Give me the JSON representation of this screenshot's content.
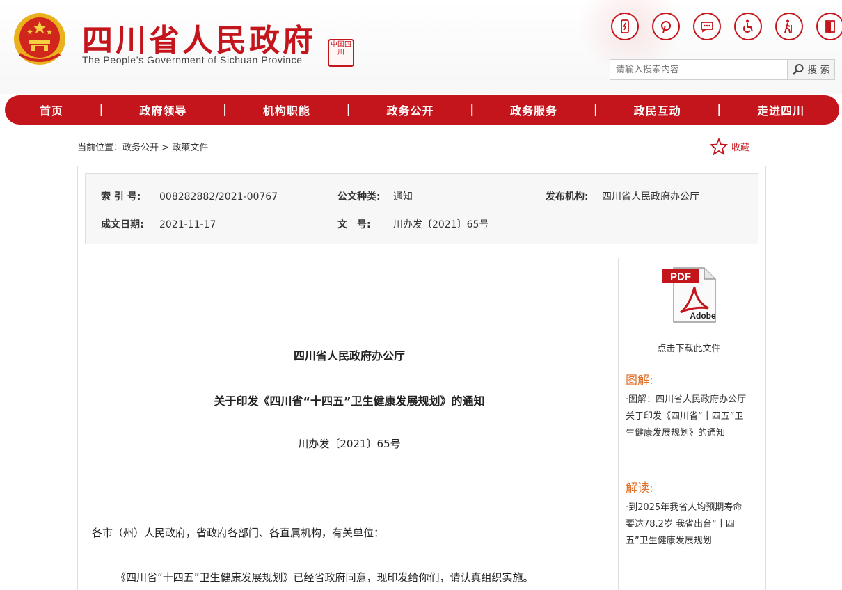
{
  "header": {
    "title": "四川省人民政府",
    "subtitle": "The People’s Government of Sichuan Province",
    "seal_text": "中国四川",
    "tools": [
      {
        "icon": "mobile-icon"
      },
      {
        "icon": "pinterest-icon"
      },
      {
        "icon": "message-icon"
      },
      {
        "icon": "accessibility-icon"
      },
      {
        "icon": "elderly-icon"
      },
      {
        "icon": "exit-icon"
      }
    ],
    "search": {
      "placeholder": "请输入搜索内容",
      "button_label": "搜 索"
    }
  },
  "nav": {
    "items": [
      "首页",
      "政府领导",
      "机构职能",
      "政务公开",
      "政务服务",
      "政民互动",
      "走进四川"
    ],
    "separator": "|"
  },
  "breadcrumb": {
    "prefix": "当前位置：",
    "level1": "政务公开",
    "sep": " > ",
    "level2": "政策文件"
  },
  "favorite": {
    "label": "收藏"
  },
  "meta": {
    "index_label": "索 引 号:",
    "index_value": "008282882/2021-00767",
    "type_label": "公文种类:",
    "type_value": "通知",
    "issuer_label": "发布机构:",
    "issuer_value": "四川省人民政府办公厅",
    "date_label": "成文日期:",
    "date_value": "2021-11-17",
    "docno_label": "文　号:",
    "docno_value": "川办发〔2021〕65号"
  },
  "document": {
    "issuer": "四川省人民政府办公厅",
    "title": "关于印发《四川省“十四五”卫生健康发展规划》的通知",
    "doc_number": "川办发〔2021〕65号",
    "recipients": "各市（州）人民政府，省政府各部门、各直属机构，有关单位：",
    "body": "《四川省“十四五”卫生健康发展规划》已经省政府同意，现印发给你们，请认真组织实施。"
  },
  "sidebar": {
    "pdf_label": "PDF",
    "pdf_brand": "Adobe",
    "download_label": "点击下载此文件",
    "graphic_heading": "图解:",
    "graphic_link": "·图解：四川省人民政府办公厅关于印发《四川省“十四五”卫生健康发展规划》的通知",
    "interpret_heading": "解读:",
    "interpret_link": "·到2025年我省人均预期寿命要达78.2岁 我省出台“十四五”卫生健康发展规划"
  },
  "colors": {
    "brand_red": "#c4151c",
    "accent_orange": "#e0702a"
  }
}
